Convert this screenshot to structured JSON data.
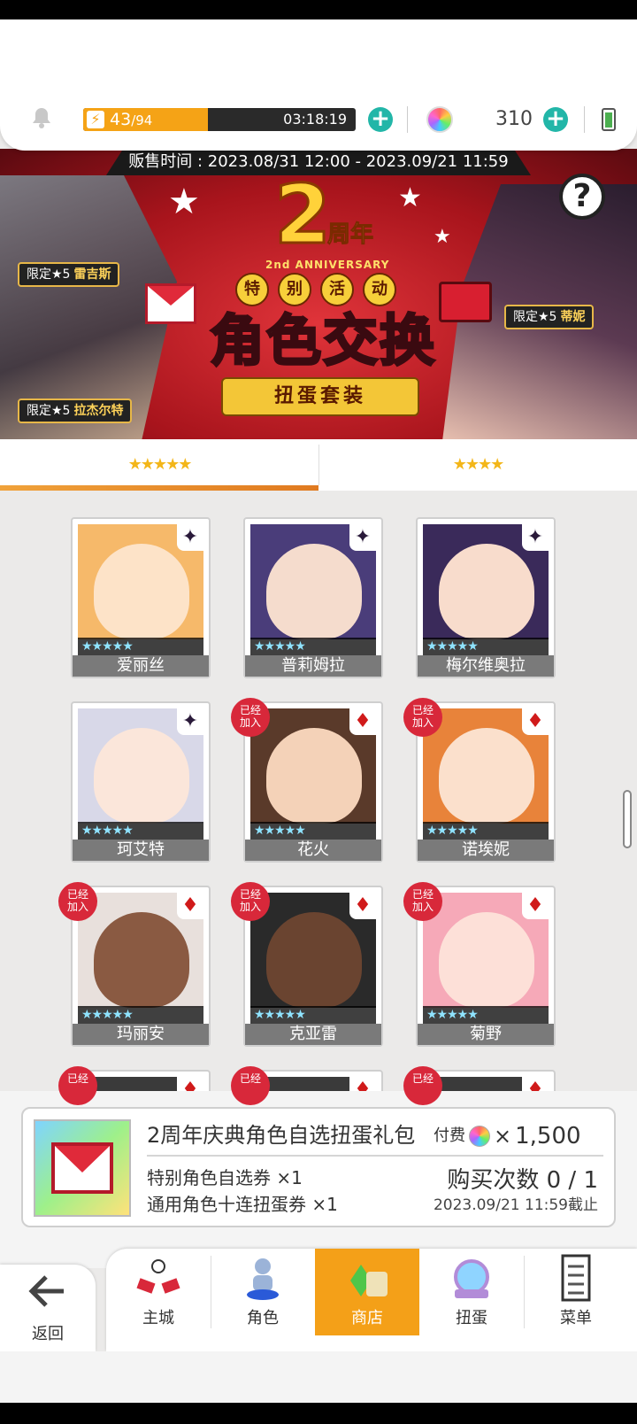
{
  "status": {
    "stamina_current": "43",
    "stamina_max": "/94",
    "stamina_fraction": 0.457,
    "timer": "03:18:19",
    "gems": "310"
  },
  "banner": {
    "sale_time": "贩售时间 : 2023.08/31 12:00 - 2023.09/21 11:59",
    "anniv_number": "2",
    "anniv_zh": "周年",
    "anniv_en": "2nd ANNIVERSARY",
    "special_chars": [
      "特",
      "别",
      "活",
      "动"
    ],
    "title": "角色交换",
    "subtitle": "扭蛋套装",
    "tag1_prefix": "限定★5",
    "tag1_name": "雷吉斯",
    "tag2_prefix": "限定★5",
    "tag2_name": "拉杰尔特",
    "tag3_prefix": "限定★5",
    "tag3_name": "蒂妮",
    "help": "?"
  },
  "tabs": [
    {
      "label": "★★★★★"
    },
    {
      "label": "★★★★"
    }
  ],
  "characters": [
    {
      "name": "爱丽丝",
      "stars": "★★★★★",
      "badge": "",
      "suit": "✦",
      "suit_color": "#2a1a3a",
      "bg": "#f6b96a",
      "face": "#fde3c8"
    },
    {
      "name": "普莉姆拉",
      "stars": "★★★★★",
      "badge": "",
      "suit": "✦",
      "suit_color": "#2a1a3a",
      "bg": "#4a3d7a",
      "face": "#f5dccd"
    },
    {
      "name": "梅尔维奥拉",
      "stars": "★★★★★",
      "badge": "",
      "suit": "✦",
      "suit_color": "#2a1a3a",
      "bg": "#3a2a5a",
      "face": "#f8dccc"
    },
    {
      "name": "珂艾特",
      "stars": "★★★★★",
      "badge": "",
      "suit": "✦",
      "suit_color": "#2a1a3a",
      "bg": "#d8d8e8",
      "face": "#fbe6da"
    },
    {
      "name": "花火",
      "stars": "★★★★★",
      "badge": "已经\n加入",
      "suit": "♦",
      "suit_color": "#d01a1a",
      "bg": "#5a3a2a",
      "face": "#f4d2b8"
    },
    {
      "name": "诺埃妮",
      "stars": "★★★★★",
      "badge": "已经\n加入",
      "suit": "♦",
      "suit_color": "#d01a1a",
      "bg": "#e8833a",
      "face": "#fbe0cc"
    },
    {
      "name": "玛丽安",
      "stars": "★★★★★",
      "badge": "已经\n加入",
      "suit": "♦",
      "suit_color": "#d01a1a",
      "bg": "#e8e0dc",
      "face": "#8a5a42"
    },
    {
      "name": "克亚雷",
      "stars": "★★★★★",
      "badge": "已经\n加入",
      "suit": "♦",
      "suit_color": "#d01a1a",
      "bg": "#2a2a2a",
      "face": "#6a4430"
    },
    {
      "name": "菊野",
      "stars": "★★★★★",
      "badge": "已经\n加入",
      "suit": "♦",
      "suit_color": "#d01a1a",
      "bg": "#f6a9b8",
      "face": "#fde0d8"
    },
    {
      "name": "",
      "stars": "",
      "badge": "已经",
      "suit": "♦",
      "suit_color": "#d01a1a",
      "bg": "#3a3a3a",
      "face": "#c8a48a"
    },
    {
      "name": "",
      "stars": "",
      "badge": "已经",
      "suit": "♦",
      "suit_color": "#d01a1a",
      "bg": "#3a3a3a",
      "face": "#c8a48a"
    },
    {
      "name": "",
      "stars": "",
      "badge": "已经",
      "suit": "♦",
      "suit_color": "#d01a1a",
      "bg": "#3a3a3a",
      "face": "#c8a48a"
    }
  ],
  "pack": {
    "title": "2周年庆典角色自选扭蛋礼包",
    "pay_label": "付费",
    "times": "×",
    "price": "1,500",
    "item1": "特别角色自选券 ×1",
    "item2": "通用角色十连扭蛋券 ×1",
    "buy_count": "购买次数 0 / 1",
    "deadline": "2023.09/21 11:59截止"
  },
  "nav": {
    "back": "返回",
    "items": [
      "主城",
      "角色",
      "商店",
      "扭蛋",
      "菜单"
    ],
    "active": "商店"
  },
  "colors": {
    "accent": "#f4a018",
    "teal": "#22b6a8",
    "badge_red": "#d8283a"
  }
}
